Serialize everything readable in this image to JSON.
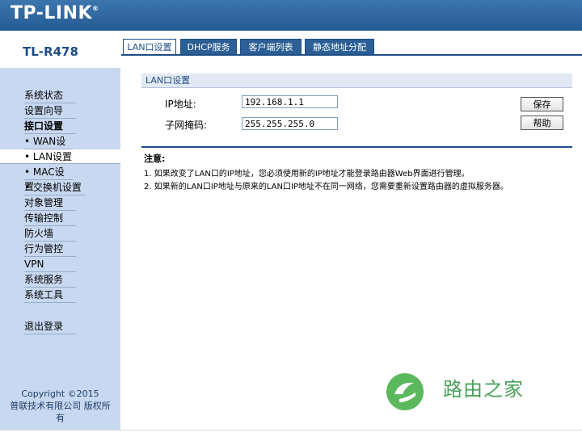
{
  "brand": {
    "logo": "TP-LINK",
    "model": "TL-R478"
  },
  "tabs": [
    {
      "label": "LAN口设置"
    },
    {
      "label": "DHCP服务"
    },
    {
      "label": "客户端列表"
    },
    {
      "label": "静态地址分配"
    }
  ],
  "sidebar": {
    "items": [
      {
        "label": "系统状态"
      },
      {
        "label": "设置向导"
      },
      {
        "label": "接口设置"
      },
      {
        "label": "• WAN设置"
      },
      {
        "label": "• LAN设置"
      },
      {
        "label": "• MAC设置"
      },
      {
        "label": "• 交换机设置"
      },
      {
        "label": "对象管理"
      },
      {
        "label": "传输控制"
      },
      {
        "label": "防火墙"
      },
      {
        "label": "行为管控"
      },
      {
        "label": "VPN"
      },
      {
        "label": "系统服务"
      },
      {
        "label": "系统工具"
      },
      {
        "label": "退出登录"
      }
    ],
    "copyright_line1": "Copyright ©2015",
    "copyright_line2": "普联技术有限公司 版权所",
    "copyright_line3": "有"
  },
  "main": {
    "section_title": "LAN口设置",
    "ip_label": "IP地址:",
    "ip_value": "192.168.1.1",
    "mask_label": "子网掩码:",
    "mask_value": "255.255.255.0",
    "save_label": "保存",
    "help_label": "帮助",
    "notes_title": "注意:",
    "notes": [
      "1. 如果改变了LAN口的IP地址，您必须使用新的IP地址才能登录路由器Web界面进行管理。",
      "2. 如果新的LAN口IP地址与原来的LAN口IP地址不在同一网络，您需要重新设置路由器的虚拟服务器。"
    ]
  },
  "watermark": {
    "text": "路由之家"
  }
}
